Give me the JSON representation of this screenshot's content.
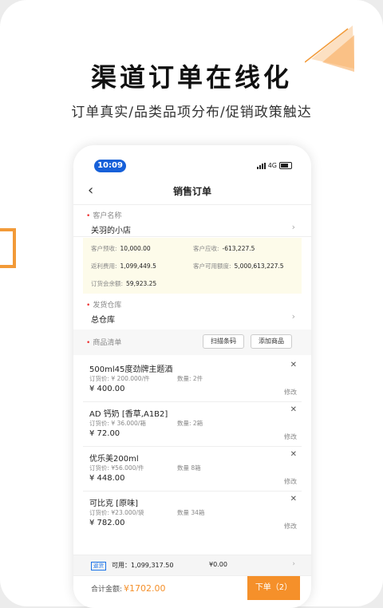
{
  "hero": {
    "title": "渠道订单在线化",
    "subtitle": "订单真实/品类品项分布/促销政策触达"
  },
  "status": {
    "time": "10:09",
    "network": "4G"
  },
  "nav": {
    "back_icon": "‹",
    "title": "销售订单"
  },
  "customer": {
    "label": "客户名称",
    "value": "关羽的小店",
    "info": {
      "prepaid_label": "客户预收:",
      "prepaid": "10,000.00",
      "receivable_label": "客户应收:",
      "receivable": "-613,227.5",
      "rebate_label": "返利费用:",
      "rebate": "1,099,449.5",
      "credit_label": "客户可用额度:",
      "credit": "5,000,613,227.5",
      "balance_label": "订货会余额:",
      "balance": "59,923.25"
    }
  },
  "warehouse": {
    "label": "发货仓库",
    "value": "总仓库"
  },
  "goods": {
    "label": "商品清单",
    "scan_button": "扫描条码",
    "add_button": "添加商品",
    "items": [
      {
        "name": "500ml45度劲牌主题酒",
        "price": "订货价: ¥ 200.000/件",
        "qty": "数量: 2件",
        "total": "¥ 400.00",
        "edit": "修改"
      },
      {
        "name": "AD 钙奶 [香草,A1B2]",
        "price": "订货价: ¥ 36.000/箱",
        "qty": "数量: 2箱",
        "total": "¥ 72.00",
        "edit": "修改"
      },
      {
        "name": "优乐美200ml",
        "price": "订货价: ¥56.000/件",
        "qty": "数量  8箱",
        "total": "¥ 448.00",
        "edit": "修改"
      },
      {
        "name": "可比克 [原味]",
        "price": "订货价: ¥23.000/袋",
        "qty": "数量  34箱",
        "total": "¥ 782.00",
        "edit": "修改"
      }
    ]
  },
  "rebate_bar": {
    "badge": "返货",
    "available": "可用：1,099,317.50",
    "amount": "¥0.00"
  },
  "checkout": {
    "total_label": "合计金额:",
    "total_value": "¥1702.00",
    "order_button": "下单（2）"
  },
  "colors": {
    "accent": "#f5902a",
    "blue": "#1660d9"
  }
}
